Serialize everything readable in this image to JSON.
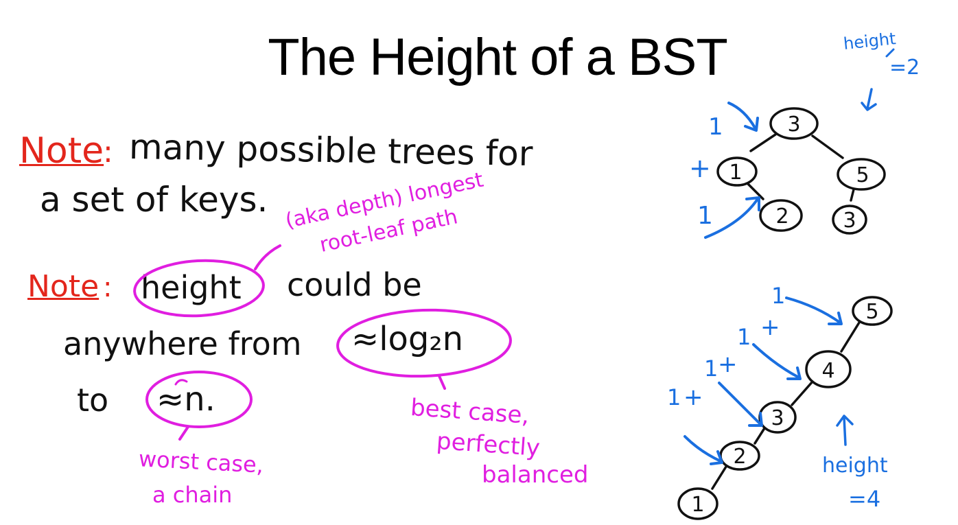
{
  "title": "The Height of a BST",
  "note1": {
    "label": "Note",
    "colon": ":",
    "line1": "many possible trees for",
    "line2": "a set of keys."
  },
  "aka": {
    "line1": "(aka depth) longest",
    "line2": "root-leaf path"
  },
  "note2": {
    "label": "Note",
    "colon": ":",
    "height_word": "height",
    "could_be": "could be",
    "anywhere": "anywhere from",
    "log_expr": "≈log₂n",
    "to": "to",
    "n_expr": "≈n.",
    "best_case_1": "best case,",
    "best_case_2": "perfectly",
    "best_case_3": "balanced",
    "worst_case_1": "worst case,",
    "worst_case_2": "a chain"
  },
  "tree1": {
    "height_label": "height",
    "height_value": "=2",
    "nodes": [
      "3",
      "1",
      "5",
      "2",
      "3"
    ],
    "edge_labels": [
      "1",
      "+",
      "1"
    ]
  },
  "tree2": {
    "height_label": "height",
    "height_value": "=4",
    "nodes": [
      "5",
      "4",
      "3",
      "2",
      "1"
    ],
    "edge_labels": [
      "1",
      "+",
      "1",
      "+",
      "1",
      "+",
      "1"
    ]
  },
  "colors": {
    "black_ink": "#111111",
    "red_ink": "#e3261c",
    "magenta_ink": "#e01ee0",
    "blue_ink": "#1a6fe0"
  }
}
